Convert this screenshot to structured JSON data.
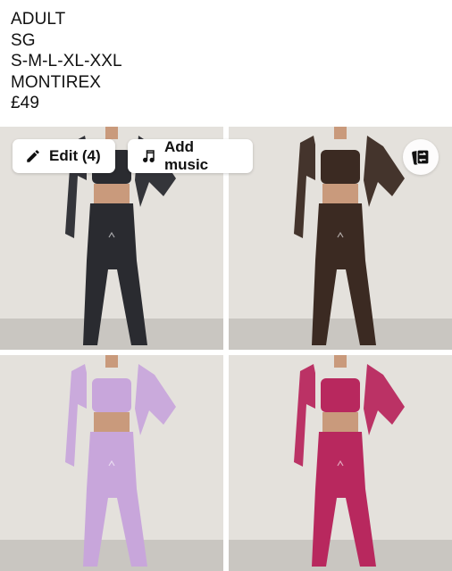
{
  "caption": {
    "line1": "ADULT",
    "line2": "SG",
    "line3": "S-M-L-XL-XXL",
    "line4": "MONTIREX",
    "line5": "£49"
  },
  "toolbar": {
    "edit_label": "Edit (4)",
    "music_label": "Add music"
  },
  "photos": [
    {
      "outfit_color": "#2a2b30",
      "name": "black-set"
    },
    {
      "outfit_color": "#3b2a22",
      "name": "brown-set"
    },
    {
      "outfit_color": "#c8a6db",
      "name": "lilac-set"
    },
    {
      "outfit_color": "#b8285e",
      "name": "pink-set"
    }
  ],
  "colors": {
    "wall": "#e4e1dc",
    "floor": "#c9c6c1",
    "skin": "#c99a7c"
  },
  "icons": {
    "edit": "pencil-icon",
    "music": "music-note-icon",
    "swap": "swap-icon"
  }
}
